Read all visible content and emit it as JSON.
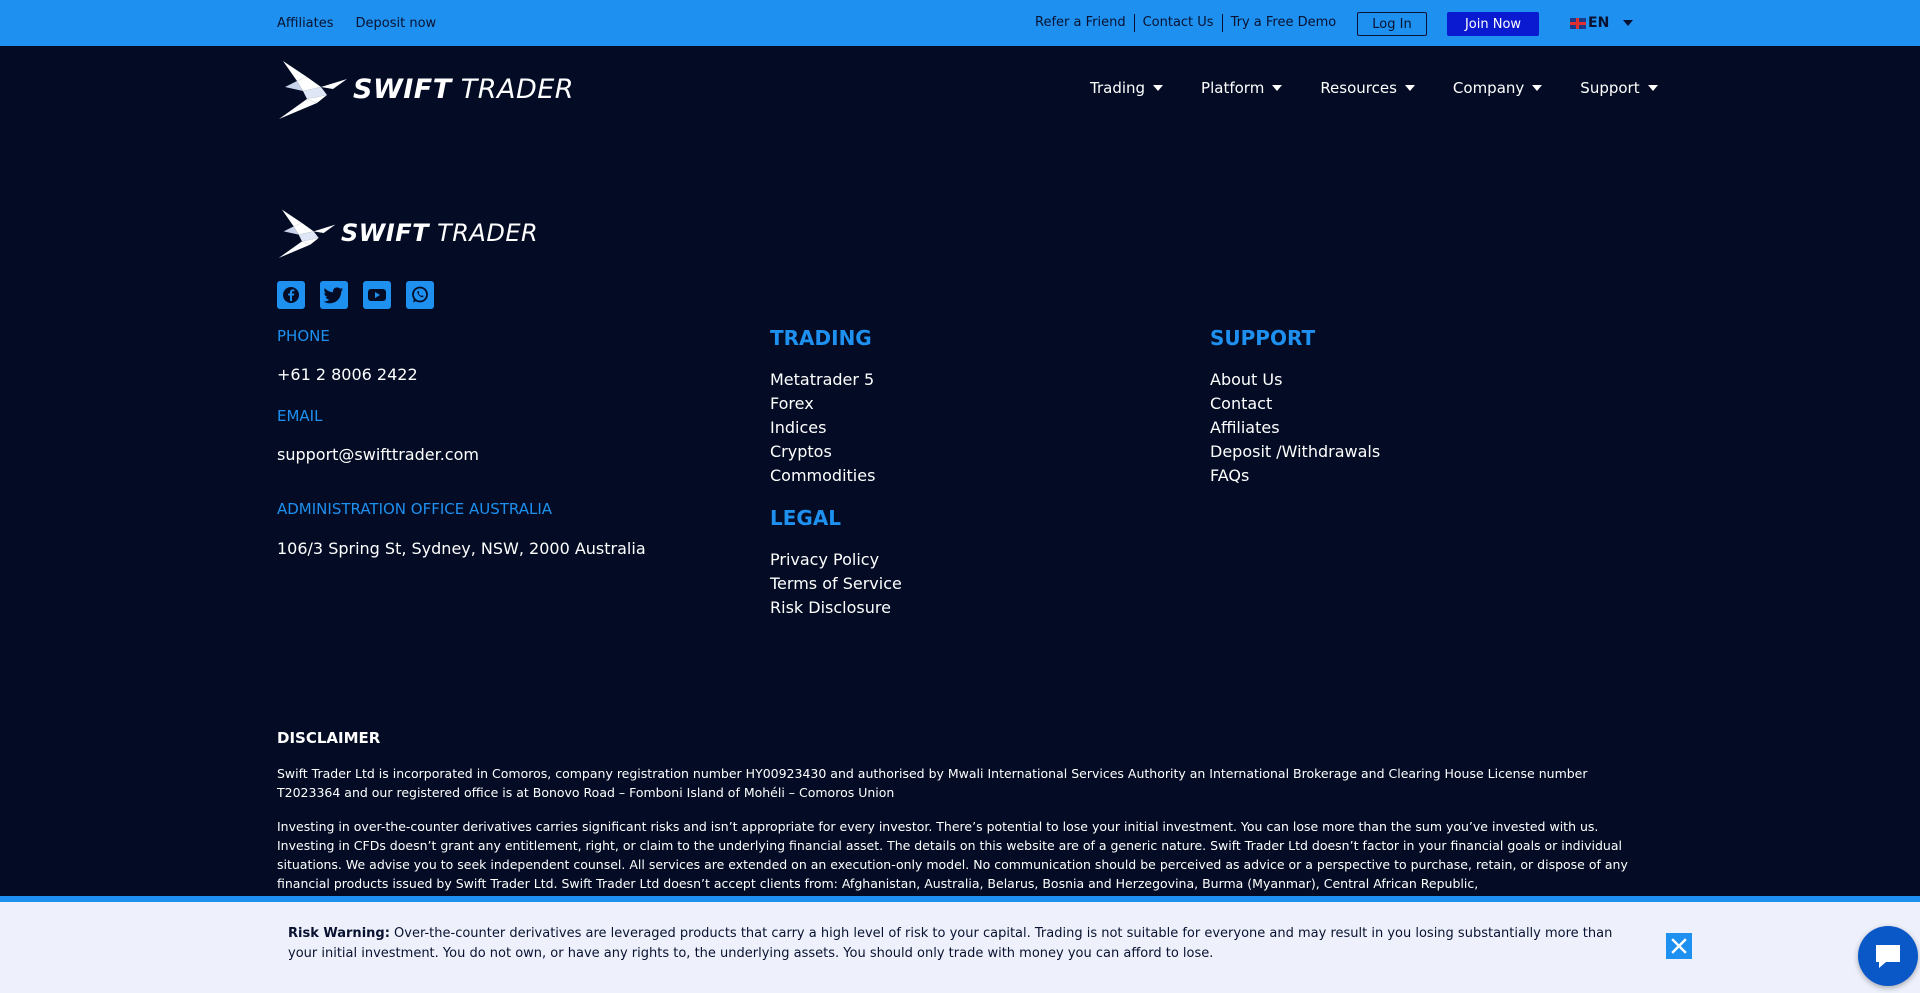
{
  "topbar": {
    "left_links": [
      "Affiliates",
      "Deposit now"
    ],
    "right_links": [
      "Refer a Friend",
      "Contact Us",
      "Try a Free Demo"
    ],
    "login_label": "Log In",
    "join_label": "Join Now",
    "language": "EN"
  },
  "brand": {
    "bold": "SWIFT",
    "light": " TRADER"
  },
  "nav": [
    "Trading",
    "Platform",
    "Resources",
    "Company",
    "Support"
  ],
  "footer": {
    "phone_label": "PHONE",
    "phone": "+61 2 8006 2422",
    "email_label": "EMAIL",
    "email": "support@swifttrader.com",
    "office_label": "ADMINISTRATION OFFICE AUSTRALIA",
    "office": "106/3 Spring St, Sydney, NSW, 2000 Australia",
    "trading_title": "TRADING",
    "trading_links": [
      "Metatrader 5",
      "Forex",
      "Indices",
      "Cryptos",
      "Commodities"
    ],
    "legal_title": "LEGAL",
    "legal_links": [
      "Privacy Policy",
      "Terms of Service",
      "Risk Disclosure"
    ],
    "support_title": "SUPPORT",
    "support_links": [
      "About Us",
      "Contact",
      "Affiliates",
      "Deposit /Withdrawals",
      "FAQs"
    ],
    "socials": [
      "facebook-icon",
      "twitter-icon",
      "youtube-icon",
      "whatsapp-icon"
    ]
  },
  "disclaimer": {
    "title": "DISCLAIMER",
    "p1": "Swift Trader Ltd is incorporated in Comoros, company registration number HY00923430 and authorised by Mwali International Services Authority an International Brokerage and Clearing House License number T2023364 and our registered office is at Bonovo Road – Fomboni Island of Mohéli – Comoros Union",
    "p2": "Investing in over-the-counter derivatives carries significant risks and isn’t appropriate for every investor. There’s potential to lose your initial investment. You can lose more than the sum you’ve invested with us. Investing in CFDs doesn’t grant any entitlement, right, or claim to the underlying financial asset. The details on this website are of a generic nature. Swift Trader Ltd doesn’t factor in your financial goals or individual situations. We advise you to seek independent counsel. All services are extended on an execution-only model. No communication should be perceived as advice or a perspective to purchase, retain, or dispose of any financial products issued by Swift Trader Ltd. Swift Trader Ltd doesn’t accept clients from: Afghanistan, Australia, Belarus, Bosnia and Herzegovina, Burma (Myanmar), Central African Republic,"
  },
  "risk": {
    "label": "Risk Warning:",
    "text": " Over-the-counter derivatives are leveraged products that carry a high level of risk to your capital. Trading is not suitable for everyone and may result in you losing substantially more than your initial investment. You do not own, or have any rights to, the underlying assets. You should only trade with money you can afford to lose."
  },
  "colors": {
    "bg": "#030c24",
    "accent": "#1e90f0",
    "join": "#0a1ad1"
  }
}
